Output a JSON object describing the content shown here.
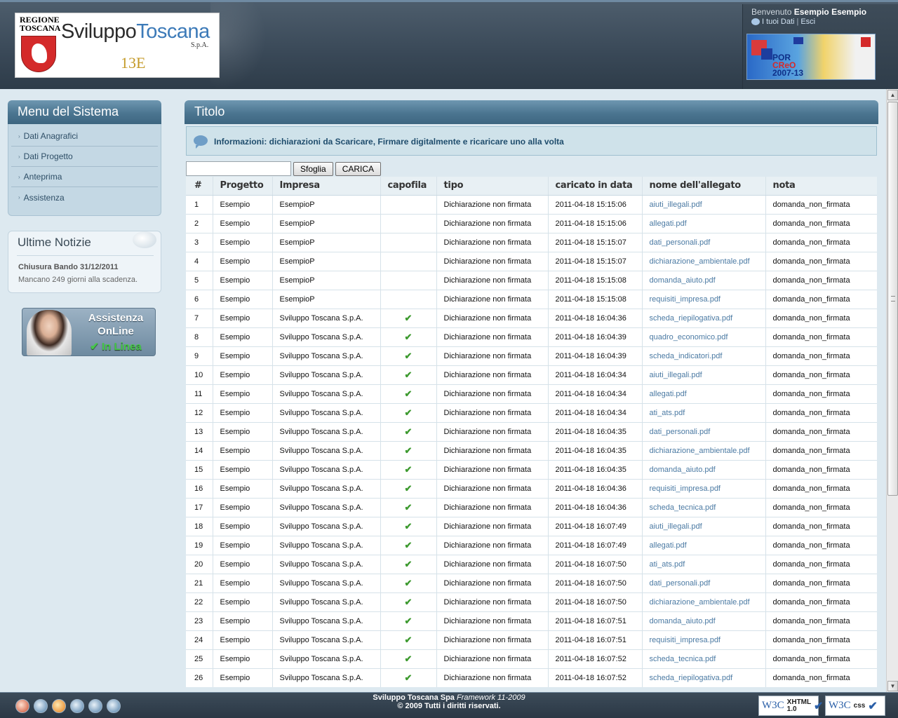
{
  "header": {
    "logo_region": "REGIONE TOSCANA",
    "logo_brand_a": "Sviluppo",
    "logo_brand_b": "Toscana",
    "logo_spa": "S.p.A.",
    "logo_code": "13E",
    "welcome_prefix": "Benvenuto",
    "welcome_user": "Esempio Esempio",
    "link_data": "I tuoi Dati",
    "link_exit": "Esci",
    "link_sep": "|",
    "banner_line1": "POR",
    "banner_line2": "CReO",
    "banner_line3": "2007-13"
  },
  "sidebar": {
    "menu_title": "Menu del Sistema",
    "items": [
      {
        "label": "Dati Anagrafici"
      },
      {
        "label": "Dati Progetto"
      },
      {
        "label": "Anteprima"
      },
      {
        "label": "Assistenza"
      }
    ],
    "news_title": "Ultime Notizie",
    "news_item_title": "Chiusura Bando 31/12/2011",
    "news_item_text": "Mancano 249 giorni alla scadenza.",
    "support_line1": "Assistenza",
    "support_line2": "OnLine",
    "support_status": "✔ In Linea"
  },
  "main": {
    "title": "Titolo",
    "info": "Informazioni: dichiarazioni da Scaricare, Firmare digitalmente e ricaricare uno alla volta",
    "browse_label": "Sfoglia",
    "upload_label": "CARICA",
    "columns": [
      "#",
      "Progetto",
      "Impresa",
      "capofila",
      "tipo",
      "caricato in data",
      "nome dell'allegato",
      "nota"
    ],
    "rows": [
      {
        "n": "1",
        "progetto": "Esempio",
        "impresa": "EsempioP",
        "capofila": false,
        "tipo": "Dichiarazione non firmata",
        "data": "2011-04-18 15:15:06",
        "allegato": "aiuti_illegali.pdf",
        "nota": "domanda_non_firmata"
      },
      {
        "n": "2",
        "progetto": "Esempio",
        "impresa": "EsempioP",
        "capofila": false,
        "tipo": "Dichiarazione non firmata",
        "data": "2011-04-18 15:15:06",
        "allegato": "allegati.pdf",
        "nota": "domanda_non_firmata"
      },
      {
        "n": "3",
        "progetto": "Esempio",
        "impresa": "EsempioP",
        "capofila": false,
        "tipo": "Dichiarazione non firmata",
        "data": "2011-04-18 15:15:07",
        "allegato": "dati_personali.pdf",
        "nota": "domanda_non_firmata"
      },
      {
        "n": "4",
        "progetto": "Esempio",
        "impresa": "EsempioP",
        "capofila": false,
        "tipo": "Dichiarazione non firmata",
        "data": "2011-04-18 15:15:07",
        "allegato": "dichiarazione_ambientale.pdf",
        "nota": "domanda_non_firmata"
      },
      {
        "n": "5",
        "progetto": "Esempio",
        "impresa": "EsempioP",
        "capofila": false,
        "tipo": "Dichiarazione non firmata",
        "data": "2011-04-18 15:15:08",
        "allegato": "domanda_aiuto.pdf",
        "nota": "domanda_non_firmata"
      },
      {
        "n": "6",
        "progetto": "Esempio",
        "impresa": "EsempioP",
        "capofila": false,
        "tipo": "Dichiarazione non firmata",
        "data": "2011-04-18 15:15:08",
        "allegato": "requisiti_impresa.pdf",
        "nota": "domanda_non_firmata"
      },
      {
        "n": "7",
        "progetto": "Esempio",
        "impresa": "Sviluppo Toscana S.p.A.",
        "capofila": true,
        "tipo": "Dichiarazione non firmata",
        "data": "2011-04-18 16:04:36",
        "allegato": "scheda_riepilogativa.pdf",
        "nota": "domanda_non_firmata"
      },
      {
        "n": "8",
        "progetto": "Esempio",
        "impresa": "Sviluppo Toscana S.p.A.",
        "capofila": true,
        "tipo": "Dichiarazione non firmata",
        "data": "2011-04-18 16:04:39",
        "allegato": "quadro_economico.pdf",
        "nota": "domanda_non_firmata"
      },
      {
        "n": "9",
        "progetto": "Esempio",
        "impresa": "Sviluppo Toscana S.p.A.",
        "capofila": true,
        "tipo": "Dichiarazione non firmata",
        "data": "2011-04-18 16:04:39",
        "allegato": "scheda_indicatori.pdf",
        "nota": "domanda_non_firmata"
      },
      {
        "n": "10",
        "progetto": "Esempio",
        "impresa": "Sviluppo Toscana S.p.A.",
        "capofila": true,
        "tipo": "Dichiarazione non firmata",
        "data": "2011-04-18 16:04:34",
        "allegato": "aiuti_illegali.pdf",
        "nota": "domanda_non_firmata"
      },
      {
        "n": "11",
        "progetto": "Esempio",
        "impresa": "Sviluppo Toscana S.p.A.",
        "capofila": true,
        "tipo": "Dichiarazione non firmata",
        "data": "2011-04-18 16:04:34",
        "allegato": "allegati.pdf",
        "nota": "domanda_non_firmata"
      },
      {
        "n": "12",
        "progetto": "Esempio",
        "impresa": "Sviluppo Toscana S.p.A.",
        "capofila": true,
        "tipo": "Dichiarazione non firmata",
        "data": "2011-04-18 16:04:34",
        "allegato": "ati_ats.pdf",
        "nota": "domanda_non_firmata"
      },
      {
        "n": "13",
        "progetto": "Esempio",
        "impresa": "Sviluppo Toscana S.p.A.",
        "capofila": true,
        "tipo": "Dichiarazione non firmata",
        "data": "2011-04-18 16:04:35",
        "allegato": "dati_personali.pdf",
        "nota": "domanda_non_firmata"
      },
      {
        "n": "14",
        "progetto": "Esempio",
        "impresa": "Sviluppo Toscana S.p.A.",
        "capofila": true,
        "tipo": "Dichiarazione non firmata",
        "data": "2011-04-18 16:04:35",
        "allegato": "dichiarazione_ambientale.pdf",
        "nota": "domanda_non_firmata"
      },
      {
        "n": "15",
        "progetto": "Esempio",
        "impresa": "Sviluppo Toscana S.p.A.",
        "capofila": true,
        "tipo": "Dichiarazione non firmata",
        "data": "2011-04-18 16:04:35",
        "allegato": "domanda_aiuto.pdf",
        "nota": "domanda_non_firmata"
      },
      {
        "n": "16",
        "progetto": "Esempio",
        "impresa": "Sviluppo Toscana S.p.A.",
        "capofila": true,
        "tipo": "Dichiarazione non firmata",
        "data": "2011-04-18 16:04:36",
        "allegato": "requisiti_impresa.pdf",
        "nota": "domanda_non_firmata"
      },
      {
        "n": "17",
        "progetto": "Esempio",
        "impresa": "Sviluppo Toscana S.p.A.",
        "capofila": true,
        "tipo": "Dichiarazione non firmata",
        "data": "2011-04-18 16:04:36",
        "allegato": "scheda_tecnica.pdf",
        "nota": "domanda_non_firmata"
      },
      {
        "n": "18",
        "progetto": "Esempio",
        "impresa": "Sviluppo Toscana S.p.A.",
        "capofila": true,
        "tipo": "Dichiarazione non firmata",
        "data": "2011-04-18 16:07:49",
        "allegato": "aiuti_illegali.pdf",
        "nota": "domanda_non_firmata"
      },
      {
        "n": "19",
        "progetto": "Esempio",
        "impresa": "Sviluppo Toscana S.p.A.",
        "capofila": true,
        "tipo": "Dichiarazione non firmata",
        "data": "2011-04-18 16:07:49",
        "allegato": "allegati.pdf",
        "nota": "domanda_non_firmata"
      },
      {
        "n": "20",
        "progetto": "Esempio",
        "impresa": "Sviluppo Toscana S.p.A.",
        "capofila": true,
        "tipo": "Dichiarazione non firmata",
        "data": "2011-04-18 16:07:50",
        "allegato": "ati_ats.pdf",
        "nota": "domanda_non_firmata"
      },
      {
        "n": "21",
        "progetto": "Esempio",
        "impresa": "Sviluppo Toscana S.p.A.",
        "capofila": true,
        "tipo": "Dichiarazione non firmata",
        "data": "2011-04-18 16:07:50",
        "allegato": "dati_personali.pdf",
        "nota": "domanda_non_firmata"
      },
      {
        "n": "22",
        "progetto": "Esempio",
        "impresa": "Sviluppo Toscana S.p.A.",
        "capofila": true,
        "tipo": "Dichiarazione non firmata",
        "data": "2011-04-18 16:07:50",
        "allegato": "dichiarazione_ambientale.pdf",
        "nota": "domanda_non_firmata"
      },
      {
        "n": "23",
        "progetto": "Esempio",
        "impresa": "Sviluppo Toscana S.p.A.",
        "capofila": true,
        "tipo": "Dichiarazione non firmata",
        "data": "2011-04-18 16:07:51",
        "allegato": "domanda_aiuto.pdf",
        "nota": "domanda_non_firmata"
      },
      {
        "n": "24",
        "progetto": "Esempio",
        "impresa": "Sviluppo Toscana S.p.A.",
        "capofila": true,
        "tipo": "Dichiarazione non firmata",
        "data": "2011-04-18 16:07:51",
        "allegato": "requisiti_impresa.pdf",
        "nota": "domanda_non_firmata"
      },
      {
        "n": "25",
        "progetto": "Esempio",
        "impresa": "Sviluppo Toscana S.p.A.",
        "capofila": true,
        "tipo": "Dichiarazione non firmata",
        "data": "2011-04-18 16:07:52",
        "allegato": "scheda_tecnica.pdf",
        "nota": "domanda_non_firmata"
      },
      {
        "n": "26",
        "progetto": "Esempio",
        "impresa": "Sviluppo Toscana S.p.A.",
        "capofila": true,
        "tipo": "Dichiarazione non firmata",
        "data": "2011-04-18 16:07:52",
        "allegato": "scheda_riepilogativa.pdf",
        "nota": "domanda_non_firmata"
      }
    ]
  },
  "footer": {
    "company": "Sviluppo Toscana Spa",
    "framework": "Framework 11-2009",
    "copyright": "© 2009 Tutti i diritti riservati.",
    "badge_xhtml_w3c": "W3C",
    "badge_xhtml_label": "XHTML 1.0",
    "badge_css_w3c": "W3C",
    "badge_css_label": "css",
    "icons": [
      "opera-icon",
      "ie-icon",
      "firefox-icon",
      "safari-icon",
      "ie7-icon",
      "ie8-icon"
    ]
  },
  "colors": {
    "header_bg": "#394857",
    "title_bar": "#4b7590",
    "link": "#4b7aa3",
    "check": "#3d9a2f"
  }
}
